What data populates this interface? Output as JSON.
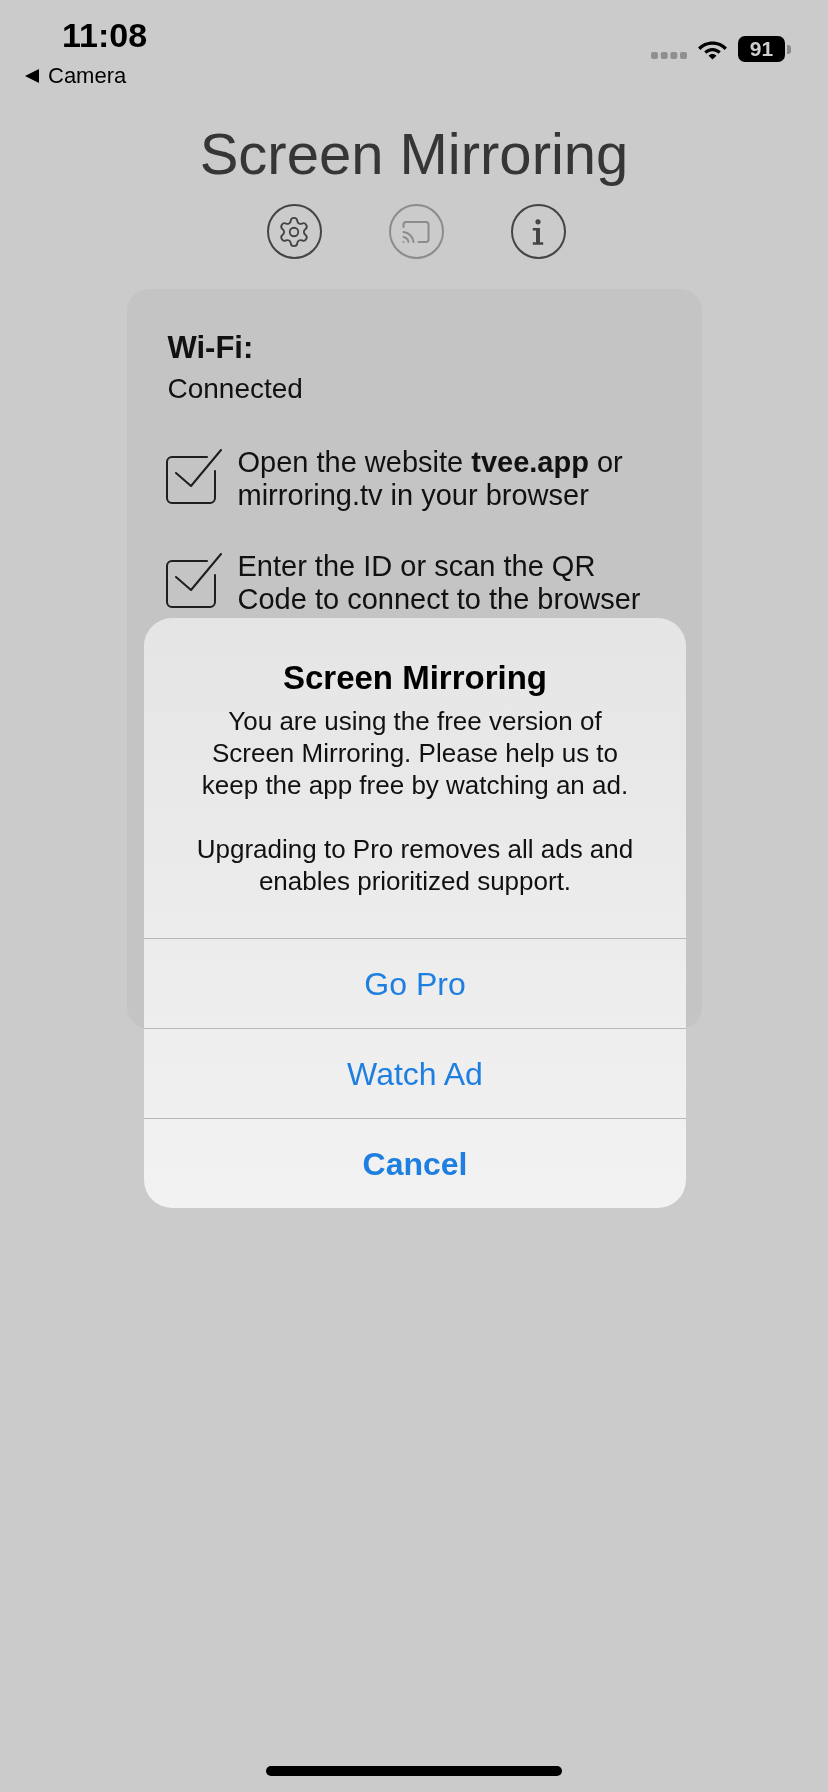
{
  "status_bar": {
    "time": "11:08",
    "back_label": "Camera",
    "battery": "91"
  },
  "header": {
    "title": "Screen Mirroring",
    "buttons": [
      {
        "kind": "settings",
        "disabled": false
      },
      {
        "kind": "cast",
        "disabled": true
      },
      {
        "kind": "info",
        "disabled": false
      }
    ]
  },
  "status_card": {
    "label": "Wi-Fi:",
    "value": "Connected",
    "steps": [
      {
        "text": "Open the website **tvee.app** or mirroring.tv in your browser",
        "checked": true
      },
      {
        "text": "Enter the ID or scan the QR Code to connect to the browser",
        "checked": true
      }
    ]
  },
  "alert": {
    "title": "Screen Mirroring",
    "message": [
      "You are using the free version of Screen Mirroring. Please help us to keep the app free by watching an ad.",
      "Upgrading to Pro removes all ads and enables prioritized support."
    ],
    "actions": [
      {
        "label": "Go Pro",
        "kind": "default"
      },
      {
        "label": "Watch Ad",
        "kind": "default"
      },
      {
        "label": "Cancel",
        "kind": "cancel"
      }
    ]
  }
}
